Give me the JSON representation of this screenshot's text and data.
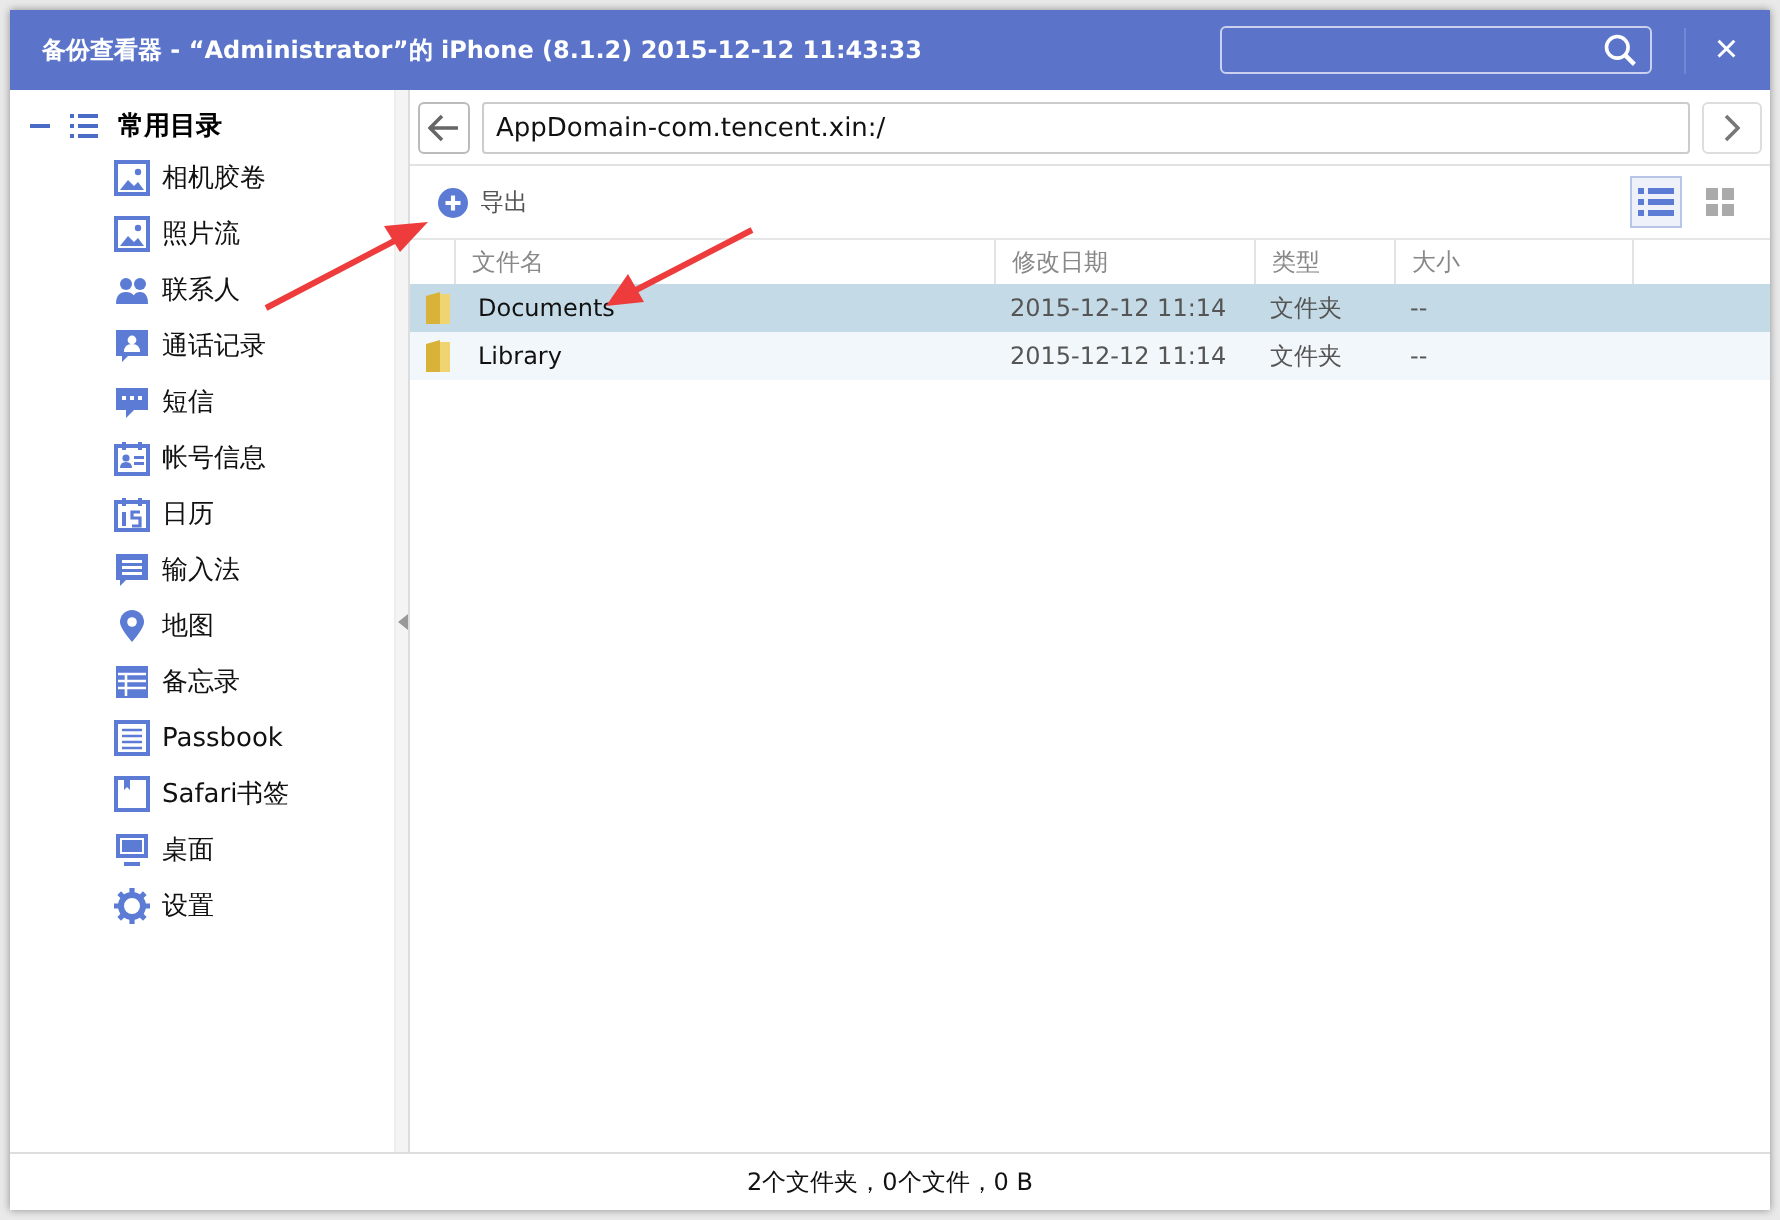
{
  "window": {
    "title": "备份查看器 - “Administrator”的 iPhone (8.1.2) 2015-12-12 11:43:33",
    "close": "×"
  },
  "sidebar": {
    "group": {
      "label": "常用目录",
      "expanded": true
    },
    "items": [
      {
        "label": "相机胶卷",
        "selected": false
      },
      {
        "label": "照片流",
        "selected": false
      },
      {
        "label": "联系人",
        "selected": false
      },
      {
        "label": "通话记录",
        "selected": false
      },
      {
        "label": "短信",
        "selected": false
      },
      {
        "label": "帐号信息",
        "selected": false
      },
      {
        "label": "日历",
        "selected": false
      },
      {
        "label": "输入法",
        "selected": false
      },
      {
        "label": "地图",
        "selected": false
      },
      {
        "label": "备忘录",
        "selected": false
      },
      {
        "label": "Passbook",
        "selected": false
      },
      {
        "label": "Safari书签",
        "selected": false
      },
      {
        "label": "桌面",
        "selected": false
      },
      {
        "label": "设置",
        "selected": false
      }
    ]
  },
  "address": {
    "value": "AppDomain-com.tencent.xin:/"
  },
  "toolbar": {
    "export_label": "导出",
    "views": [
      {
        "selected": true
      },
      {
        "selected": false
      }
    ]
  },
  "table": {
    "columns": [
      "文件名",
      "修改日期",
      "类型",
      "大小"
    ],
    "rows": [
      {
        "cells": [
          "Documents",
          "2015-12-12 11:14",
          "文件夹",
          "--"
        ],
        "selected": true
      },
      {
        "cells": [
          "Library",
          "2015-12-12 11:14",
          "文件夹",
          "--"
        ],
        "selected": false
      }
    ]
  },
  "status_bar": "2个文件夹，0个文件，0 B"
}
